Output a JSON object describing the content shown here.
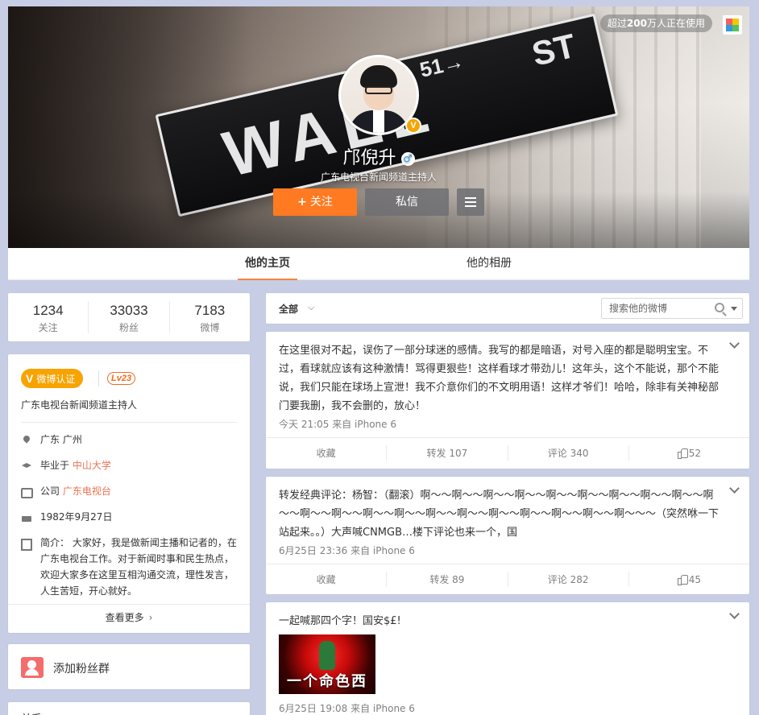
{
  "header": {
    "users_badge_prefix": "超过",
    "users_badge_count": "200",
    "users_badge_suffix": "万人正在使用",
    "sign_text": "WALL",
    "sign_text2": "ST",
    "sign_number": "51→",
    "profile_name": "邝倪升",
    "gender_symbol": "♂",
    "verified_symbol": "V",
    "profile_desc": "广东电视台新闻频道主持人",
    "follow_label": "关注",
    "follow_plus": "+",
    "message_label": "私信"
  },
  "tabs": [
    {
      "label": "他的主页",
      "active": true
    },
    {
      "label": "他的相册",
      "active": false
    }
  ],
  "stats": [
    {
      "value": "1234",
      "label": "关注"
    },
    {
      "value": "33033",
      "label": "粉丝"
    },
    {
      "value": "7183",
      "label": "微博"
    }
  ],
  "info": {
    "verified_label": "微博认证",
    "verified_mark": "V",
    "level": "Lv23",
    "title": "广东电视台新闻频道主持人",
    "location": "广东 广州",
    "education_prefix": "毕业于",
    "education_school": "中山大学",
    "company_prefix": "公司",
    "company_name": "广东电视台",
    "birthday": "1982年9月27日",
    "bio": "简介： 大家好，我是做新闻主播和记者的，在广东电视台工作。对于新闻时事和民生热点，欢迎大家多在这里互相沟通交流，理性发言，人生苦短，开心就好。",
    "more_label": "查看更多",
    "more_chevron": "›"
  },
  "fans_group": {
    "label": "添加粉丝群"
  },
  "bottom_card": {
    "label": "关系"
  },
  "filter": {
    "all_label": "全部",
    "all_chevron": "⌵",
    "search_placeholder": "搜索他的微博"
  },
  "posts": [
    {
      "text": "在这里很对不起，误伤了一部分球迷的感情。我写的都是暗语，对号入座的都是聪明宝宝。不过，看球就应该有这种激情！骂得更狠些！这样看球才带劲儿！这年头，这个不能说，那个不能说，我们只能在球场上宣泄！我不介意你们的不文明用语！这样才爷们！哈哈，除非有关神秘部门要我删，我不会删的，放心！",
      "meta": "今天 21:05 来自 iPhone 6",
      "favorite": "收藏",
      "repost": "转发 107",
      "comment": "评论 340",
      "likes": "52"
    },
    {
      "text": "转发经典评论：杨智：（翻滚）啊～～啊～～啊～～啊～～啊～～啊～～啊～～啊～～啊～～啊～～啊～～啊～～啊～～啊～～啊～～啊～～啊～～啊～～啊～～啊～～啊～～～（突然咻一下站起来。。）大声喊CNMGB…楼下评论也来一个，国",
      "meta": "6月25日 23:36 来自 iPhone 6",
      "favorite": "收藏",
      "repost": "转发 89",
      "comment": "评论 282",
      "likes": "45"
    },
    {
      "text": "一起喊那四个字！国安$£!",
      "image_caption": "一个命色西",
      "meta": "6月25日 19:08 来自 iPhone 6"
    }
  ]
}
